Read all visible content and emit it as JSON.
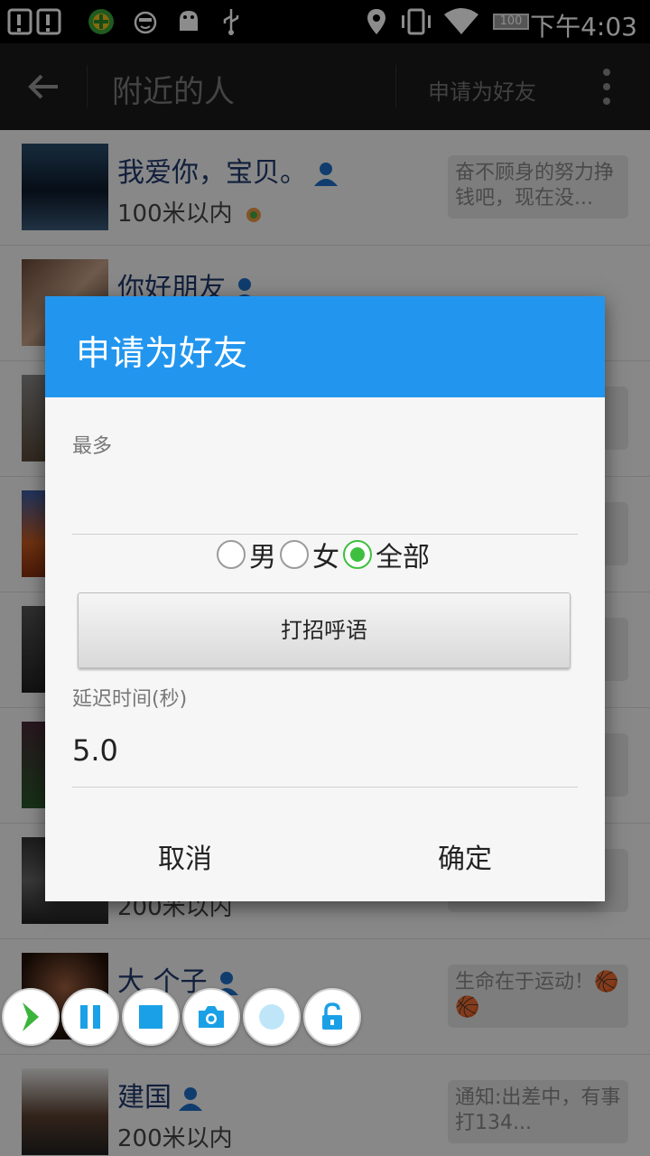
{
  "status_bar": {
    "time": "下午4:03",
    "battery": "100"
  },
  "app_bar": {
    "title": "附近的人",
    "action": "申请为好友"
  },
  "list": {
    "rows": [
      {
        "name": "我爱你，宝贝。",
        "distance": "100米以内",
        "signature": "奋不顾身的努力挣钱吧，现在没..."
      },
      {
        "name": "你好朋友",
        "distance": "",
        "signature": ""
      },
      {
        "name": "",
        "distance": "",
        "signature": ""
      },
      {
        "name": "",
        "distance": "",
        "signature": "..."
      },
      {
        "name": "",
        "distance": "",
        "signature": ""
      },
      {
        "name": "",
        "distance": "",
        "signature": ""
      },
      {
        "name": "",
        "distance": "200米以内",
        "signature": "..."
      },
      {
        "name": "大 个子",
        "distance": "",
        "signature": "生命在于运动！🏀 🏀"
      },
      {
        "name": "建国",
        "distance": "200米以内",
        "signature": "通知:出差中，有事打134..."
      }
    ]
  },
  "dialog": {
    "title": "申请为好友",
    "max_label": "最多",
    "max_value": "",
    "radio_male": "男",
    "radio_female": "女",
    "radio_all": "全部",
    "selected": "全部",
    "greeting_button": "打招呼语",
    "delay_label": "延迟时间(秒)",
    "delay_value": "5.0",
    "cancel": "取消",
    "confirm": "确定"
  },
  "floating_toolbar": {
    "buttons": [
      "expand-icon",
      "pause-icon",
      "stop-icon",
      "camera-icon",
      "record-icon",
      "unlock-icon"
    ],
    "accent": "#1aa0e6"
  },
  "colors": {
    "dialog_header": "#2296ef",
    "radio_checked": "#3fbf3f",
    "name_text": "#1f3a6e"
  }
}
